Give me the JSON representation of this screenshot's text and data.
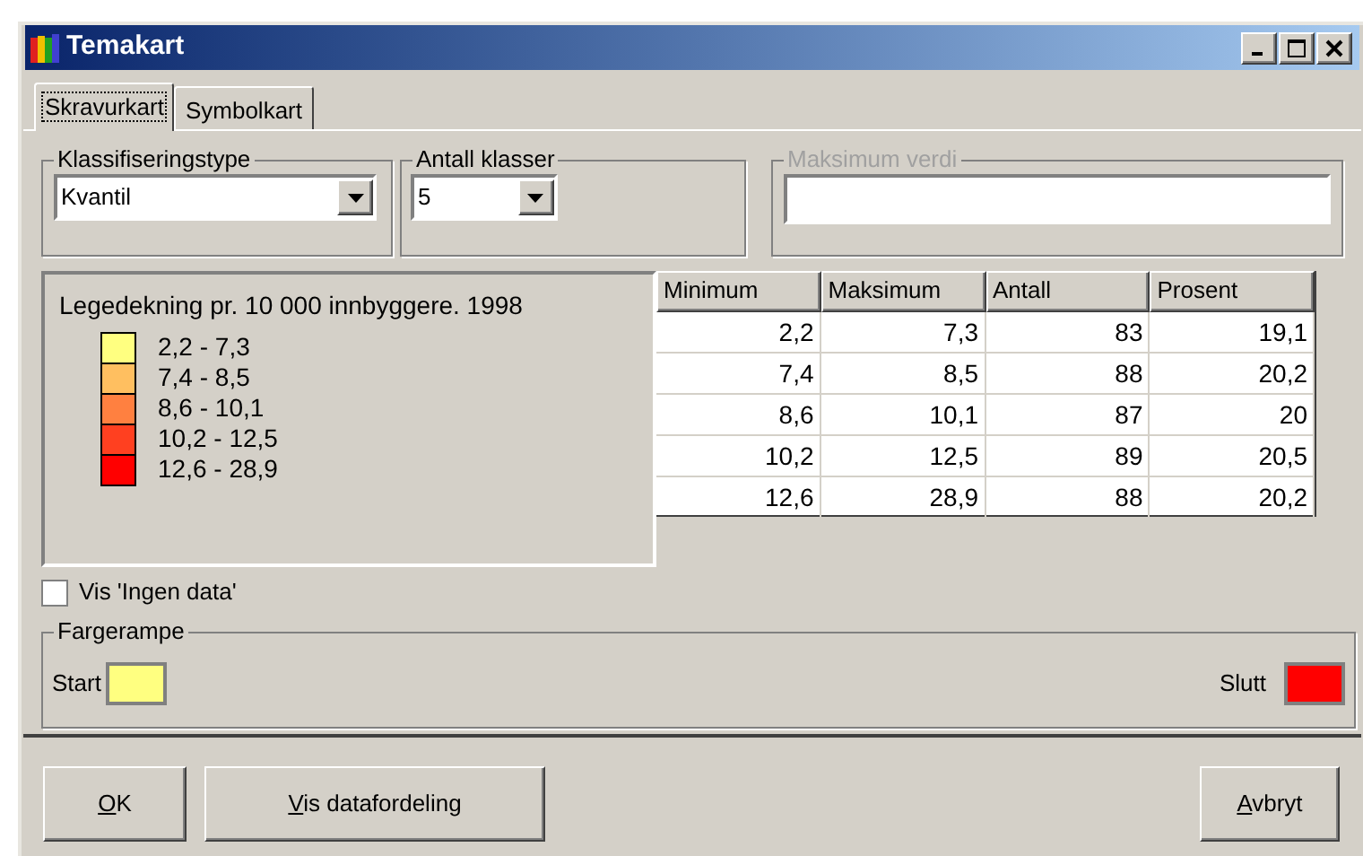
{
  "window": {
    "title": "Temakart"
  },
  "tabs": [
    {
      "label": "Skravurkart",
      "selected": true
    },
    {
      "label": "Symbolkart",
      "selected": false
    }
  ],
  "classification_type": {
    "label": "Klassifiseringstype",
    "value": "Kvantil"
  },
  "class_count": {
    "label": "Antall klasser",
    "value": "5"
  },
  "max_value": {
    "label": "Maksimum verdi",
    "disabled": true
  },
  "legend": {
    "title": "Legedekning pr. 10 000 innbyggere. 1998",
    "items": [
      {
        "label": "2,2 - 7,3",
        "color": "#ffff80"
      },
      {
        "label": "7,4 - 8,5",
        "color": "#ffbf60"
      },
      {
        "label": "8,6 - 10,1",
        "color": "#ff8040"
      },
      {
        "label": "10,2 - 12,5",
        "color": "#ff4020"
      },
      {
        "label": "12,6 - 28,9",
        "color": "#ff0000"
      }
    ]
  },
  "table": {
    "columns": [
      "Minimum",
      "Maksimum",
      "Antall",
      "Prosent"
    ],
    "rows": [
      [
        "2,2",
        "7,3",
        "83",
        "19,1"
      ],
      [
        "7,4",
        "8,5",
        "88",
        "20,2"
      ],
      [
        "8,6",
        "10,1",
        "87",
        "20"
      ],
      [
        "10,2",
        "12,5",
        "89",
        "20,5"
      ],
      [
        "12,6",
        "28,9",
        "88",
        "20,2"
      ]
    ]
  },
  "show_no_data": {
    "label": "Vis 'Ingen data'",
    "checked": false
  },
  "color_ramp": {
    "label": "Fargerampe",
    "start": {
      "label": "Start",
      "color": "#ffff80"
    },
    "end": {
      "label": "Slutt",
      "color": "#ff0000"
    }
  },
  "buttons_left": [
    {
      "label": "OK",
      "accelerator": true
    },
    {
      "label": "Vis datafordeling",
      "accelerator": true
    }
  ],
  "buttons_right": [
    {
      "label": "Avbryt",
      "accelerator": true
    }
  ]
}
